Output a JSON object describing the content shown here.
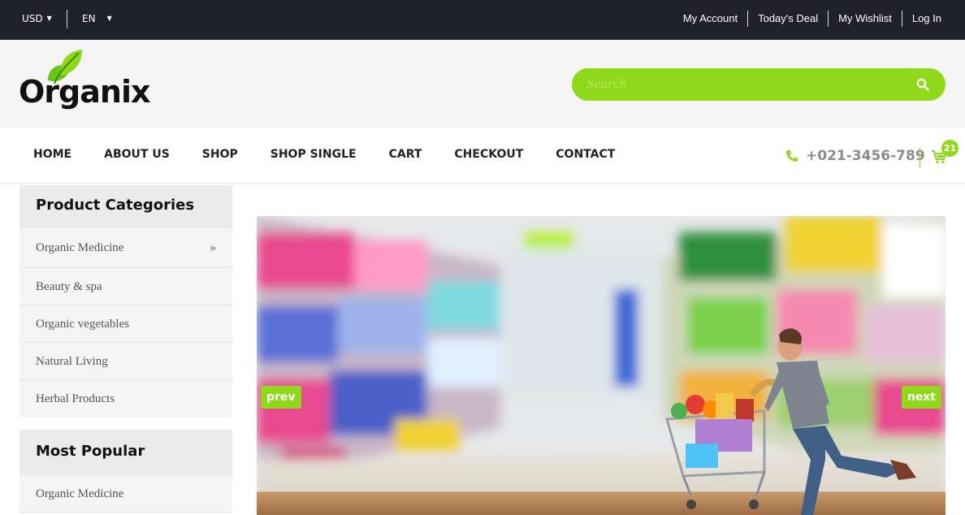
{
  "topbar": {
    "currency": "USD",
    "language": "EN",
    "links": [
      "My Account",
      "Today's Deal",
      "My Wishlist",
      "Log In"
    ]
  },
  "header": {
    "logo_text": "Organix",
    "search_placeholder": "Search"
  },
  "nav": {
    "items": [
      "HOME",
      "ABOUT US",
      "SHOP",
      "SHOP SINGLE",
      "CART",
      "CHECKOUT",
      "CONTACT"
    ],
    "phone": "+021-3456-789",
    "cart_count": "21"
  },
  "sidebar": {
    "categories_title": "Product Categories",
    "categories": [
      "Organic Medicine",
      "Beauty & spa",
      "Organic vegetables",
      "Natural Living",
      "Herbal Products"
    ],
    "expand_arrow": "»",
    "popular_title": "Most Popular",
    "popular": [
      "Organic Medicine"
    ]
  },
  "slider": {
    "prev_label": "prev",
    "next_label": "next"
  },
  "colors": {
    "accent": "#8fd81a",
    "topbar": "#20202c",
    "header_bg": "#f5f5f5"
  },
  "icons": {
    "search": "search-icon",
    "phone": "phone-icon",
    "cart": "cart-icon",
    "dropdown": "caret-down-icon",
    "logo_leaf": "leaf-icon"
  }
}
